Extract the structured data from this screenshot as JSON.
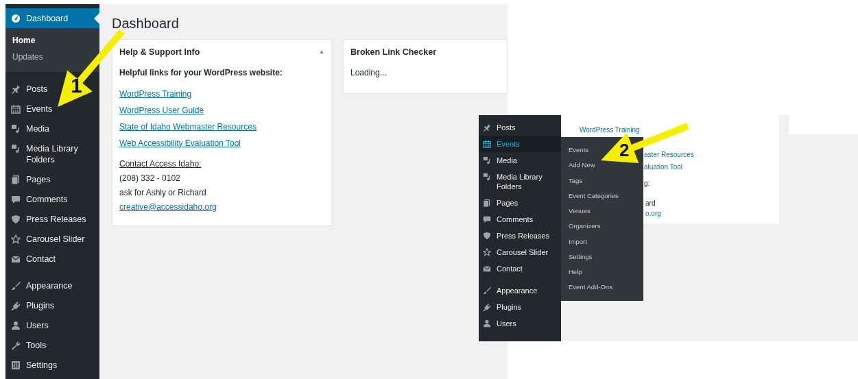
{
  "main_screen": {
    "sidebar": {
      "dashboard": {
        "label": "Dashboard",
        "selected": true,
        "submenu": [
          {
            "label": "Home",
            "selected": true
          },
          {
            "label": "Updates",
            "selected": false
          }
        ]
      },
      "groups": [
        [
          {
            "label": "Posts",
            "selected": false
          },
          {
            "label": "Events",
            "selected": false
          },
          {
            "label": "Media",
            "selected": false
          },
          {
            "label": "Media Library Folders",
            "selected": false
          },
          {
            "label": "Pages",
            "selected": false
          },
          {
            "label": "Comments",
            "selected": false
          },
          {
            "label": "Press Releases",
            "selected": false
          },
          {
            "label": "Carousel Slider",
            "selected": false
          },
          {
            "label": "Contact",
            "selected": false
          }
        ],
        [
          {
            "label": "Appearance",
            "selected": false
          },
          {
            "label": "Plugins",
            "selected": false
          },
          {
            "label": "Users",
            "selected": false
          },
          {
            "label": "Tools",
            "selected": false
          },
          {
            "label": "Settings",
            "selected": false
          }
        ]
      ]
    },
    "page_title": "Dashboard",
    "widgets": [
      {
        "title": "Help & Support Info",
        "toggle": "▲",
        "intro": "Helpful links for your WordPress website:",
        "links": [
          "WordPress Training",
          "WordPress User Guide",
          "State of Idaho Webmaster Resources",
          "Web Accessibility Evaluation Tool"
        ],
        "contact_heading": "Contact Access Idaho:",
        "contact_lines": [
          "(208) 332 - 0102",
          "ask for Ashly or Richard"
        ],
        "email": "creative@accessidaho.org"
      },
      {
        "title": "Broken Link Checker",
        "body": "Loading..."
      }
    ],
    "annotation": "1"
  },
  "inset_screen": {
    "sidebar": {
      "groups": [
        [
          {
            "label": "Posts",
            "selected": false
          },
          {
            "label": "Events",
            "selected": true
          },
          {
            "label": "Media",
            "selected": false
          },
          {
            "label": "Media Library Folders",
            "selected": false
          },
          {
            "label": "Pages",
            "selected": false
          },
          {
            "label": "Comments",
            "selected": false
          },
          {
            "label": "Press Releases",
            "selected": false
          },
          {
            "label": "Carousel Slider",
            "selected": false
          },
          {
            "label": "Contact",
            "selected": false
          }
        ],
        [
          {
            "label": "Appearance",
            "selected": false
          },
          {
            "label": "Plugins",
            "selected": false
          },
          {
            "label": "Users",
            "selected": false
          }
        ]
      ]
    },
    "flyout": [
      "Events",
      "Add New",
      "Tags",
      "Event Categories",
      "Venues",
      "Organizers",
      "Import",
      "Settings",
      "Help",
      "Event Add-Ons"
    ],
    "background_texts": [
      {
        "kind": "link",
        "text": "WordPress Training"
      },
      {
        "kind": "link",
        "text": "aster Resources"
      },
      {
        "kind": "link",
        "text": "aluation Tool"
      },
      {
        "kind": "plain",
        "text": "g:"
      },
      {
        "kind": "plain",
        "text": "ard"
      },
      {
        "kind": "link",
        "text": "o.org"
      }
    ],
    "annotation": "2"
  }
}
